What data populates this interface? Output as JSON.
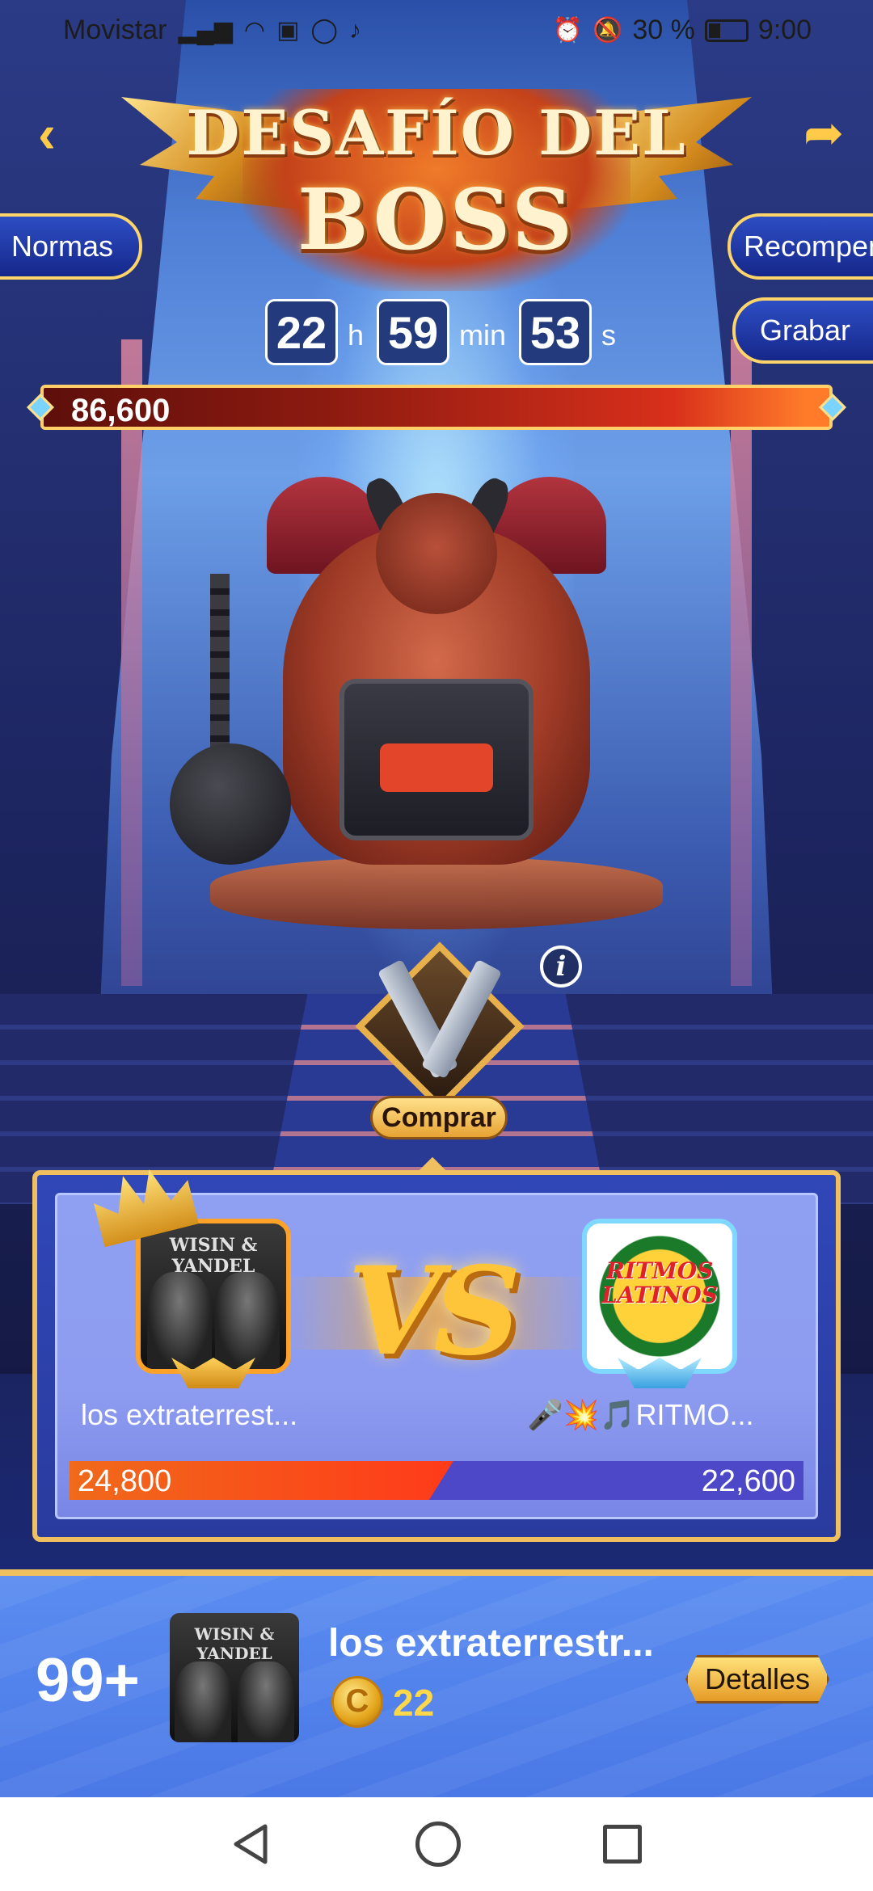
{
  "status_bar": {
    "carrier": "Movistar",
    "battery_percent": "30 %",
    "time": "9:00"
  },
  "header": {
    "title_line1": "DESAFÍO DEL",
    "title_line2": "BOSS"
  },
  "buttons": {
    "rules": "Normas",
    "rewards": "Recompens",
    "record": "Grabar",
    "buy": "Comprar",
    "details": "Detalles"
  },
  "timer": {
    "hours": "22",
    "hours_unit": "h",
    "minutes": "59",
    "minutes_unit": "min",
    "seconds": "53",
    "seconds_unit": "s"
  },
  "boss": {
    "hp": "86,600"
  },
  "versus": {
    "left": {
      "name": "los extraterrest...",
      "avatar_text": "WISIN & YANDEL",
      "score": "24,800"
    },
    "right": {
      "name": "🎤💥🎵RITMO...",
      "avatar_text": "RITMOS LATINOS",
      "score": "22,600"
    },
    "vs_label": "VS",
    "left_share": 0.523
  },
  "ranking": {
    "rank": "99+",
    "name": "los extraterrestr...",
    "avatar_text": "WISIN & YANDEL",
    "coins": "22"
  },
  "colors": {
    "accent_gold": "#f0c060",
    "hp_red": "#d8301b",
    "left_score": "#f06a1a",
    "right_score": "#4c48c8"
  }
}
